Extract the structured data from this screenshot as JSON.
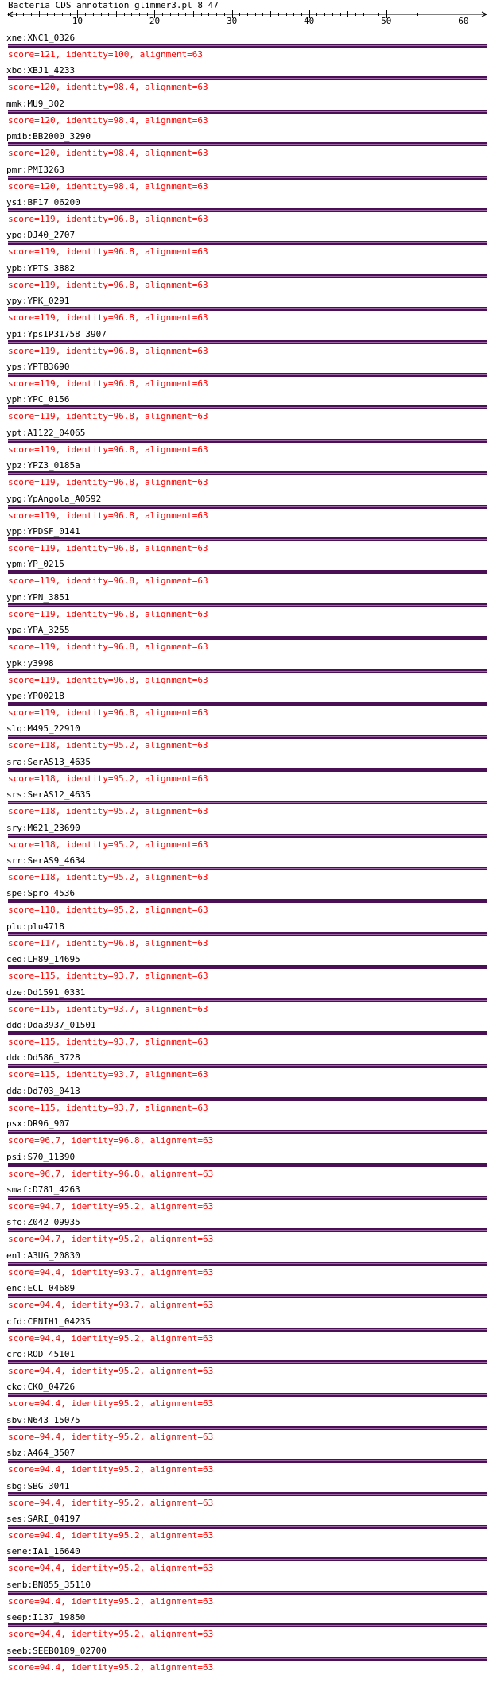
{
  "page": {
    "title": "Bacteria_CDS_annotation_glimmer3.pl_8_47"
  },
  "colors": {
    "score_text": "#ff0000",
    "bar": "#4b0f56",
    "bar_highlight": "#a06aa9",
    "ruler": "#000000"
  },
  "ruler": {
    "min": 1,
    "max": 63,
    "major_step": 10,
    "tick_labels": [
      "10",
      "20",
      "30",
      "40",
      "50",
      "60"
    ]
  },
  "hits": [
    {
      "name": "xne:XNC1_0326",
      "score": "score=121, identity=100, alignment=63"
    },
    {
      "name": "xbo:XBJ1_4233",
      "score": "score=120, identity=98.4, alignment=63"
    },
    {
      "name": "mmk:MU9_302",
      "score": "score=120, identity=98.4, alignment=63"
    },
    {
      "name": "pmib:BB2000_3290",
      "score": "score=120, identity=98.4, alignment=63"
    },
    {
      "name": "pmr:PMI3263",
      "score": "score=120, identity=98.4, alignment=63"
    },
    {
      "name": "ysi:BF17_06200",
      "score": "score=119, identity=96.8, alignment=63"
    },
    {
      "name": "ypq:DJ40_2707",
      "score": "score=119, identity=96.8, alignment=63"
    },
    {
      "name": "ypb:YPTS_3882",
      "score": "score=119, identity=96.8, alignment=63"
    },
    {
      "name": "ypy:YPK_0291",
      "score": "score=119, identity=96.8, alignment=63"
    },
    {
      "name": "ypi:YpsIP31758_3907",
      "score": "score=119, identity=96.8, alignment=63"
    },
    {
      "name": "yps:YPTB3690",
      "score": "score=119, identity=96.8, alignment=63"
    },
    {
      "name": "yph:YPC_0156",
      "score": "score=119, identity=96.8, alignment=63"
    },
    {
      "name": "ypt:A1122_04065",
      "score": "score=119, identity=96.8, alignment=63"
    },
    {
      "name": "ypz:YPZ3_0185a",
      "score": "score=119, identity=96.8, alignment=63"
    },
    {
      "name": "ypg:YpAngola_A0592",
      "score": "score=119, identity=96.8, alignment=63"
    },
    {
      "name": "ypp:YPDSF_0141",
      "score": "score=119, identity=96.8, alignment=63"
    },
    {
      "name": "ypm:YP_0215",
      "score": "score=119, identity=96.8, alignment=63"
    },
    {
      "name": "ypn:YPN_3851",
      "score": "score=119, identity=96.8, alignment=63"
    },
    {
      "name": "ypa:YPA_3255",
      "score": "score=119, identity=96.8, alignment=63"
    },
    {
      "name": "ypk:y3998",
      "score": "score=119, identity=96.8, alignment=63"
    },
    {
      "name": "ype:YPO0218",
      "score": "score=119, identity=96.8, alignment=63"
    },
    {
      "name": "slq:M495_22910",
      "score": "score=118, identity=95.2, alignment=63"
    },
    {
      "name": "sra:SerAS13_4635",
      "score": "score=118, identity=95.2, alignment=63"
    },
    {
      "name": "srs:SerAS12_4635",
      "score": "score=118, identity=95.2, alignment=63"
    },
    {
      "name": "sry:M621_23690",
      "score": "score=118, identity=95.2, alignment=63"
    },
    {
      "name": "srr:SerAS9_4634",
      "score": "score=118, identity=95.2, alignment=63"
    },
    {
      "name": "spe:Spro_4536",
      "score": "score=118, identity=95.2, alignment=63"
    },
    {
      "name": "plu:plu4718",
      "score": "score=117, identity=96.8, alignment=63"
    },
    {
      "name": "ced:LH89_14695",
      "score": "score=115, identity=93.7, alignment=63"
    },
    {
      "name": "dze:Dd1591_0331",
      "score": "score=115, identity=93.7, alignment=63"
    },
    {
      "name": "ddd:Dda3937_01501",
      "score": "score=115, identity=93.7, alignment=63"
    },
    {
      "name": "ddc:Dd586_3728",
      "score": "score=115, identity=93.7, alignment=63"
    },
    {
      "name": "dda:Dd703_0413",
      "score": "score=115, identity=93.7, alignment=63"
    },
    {
      "name": "psx:DR96_907",
      "score": "score=96.7, identity=96.8, alignment=63"
    },
    {
      "name": "psi:S70_11390",
      "score": "score=96.7, identity=96.8, alignment=63"
    },
    {
      "name": "smaf:D781_4263",
      "score": "score=94.7, identity=95.2, alignment=63"
    },
    {
      "name": "sfo:Z042_09935",
      "score": "score=94.7, identity=95.2, alignment=63"
    },
    {
      "name": "enl:A3UG_20830",
      "score": "score=94.4, identity=93.7, alignment=63"
    },
    {
      "name": "enc:ECL_04689",
      "score": "score=94.4, identity=93.7, alignment=63"
    },
    {
      "name": "cfd:CFNIH1_04235",
      "score": "score=94.4, identity=95.2, alignment=63"
    },
    {
      "name": "cro:ROD_45101",
      "score": "score=94.4, identity=95.2, alignment=63"
    },
    {
      "name": "cko:CKO_04726",
      "score": "score=94.4, identity=95.2, alignment=63"
    },
    {
      "name": "sbv:N643_15075",
      "score": "score=94.4, identity=95.2, alignment=63"
    },
    {
      "name": "sbz:A464_3507",
      "score": "score=94.4, identity=95.2, alignment=63"
    },
    {
      "name": "sbg:SBG_3041",
      "score": "score=94.4, identity=95.2, alignment=63"
    },
    {
      "name": "ses:SARI_04197",
      "score": "score=94.4, identity=95.2, alignment=63"
    },
    {
      "name": "sene:IA1_16640",
      "score": "score=94.4, identity=95.2, alignment=63"
    },
    {
      "name": "senb:BN855_35110",
      "score": "score=94.4, identity=95.2, alignment=63"
    },
    {
      "name": "seep:I137_19850",
      "score": "score=94.4, identity=95.2, alignment=63"
    },
    {
      "name": "seeb:SEEB0189_02700",
      "score": "score=94.4, identity=95.2, alignment=63"
    }
  ]
}
